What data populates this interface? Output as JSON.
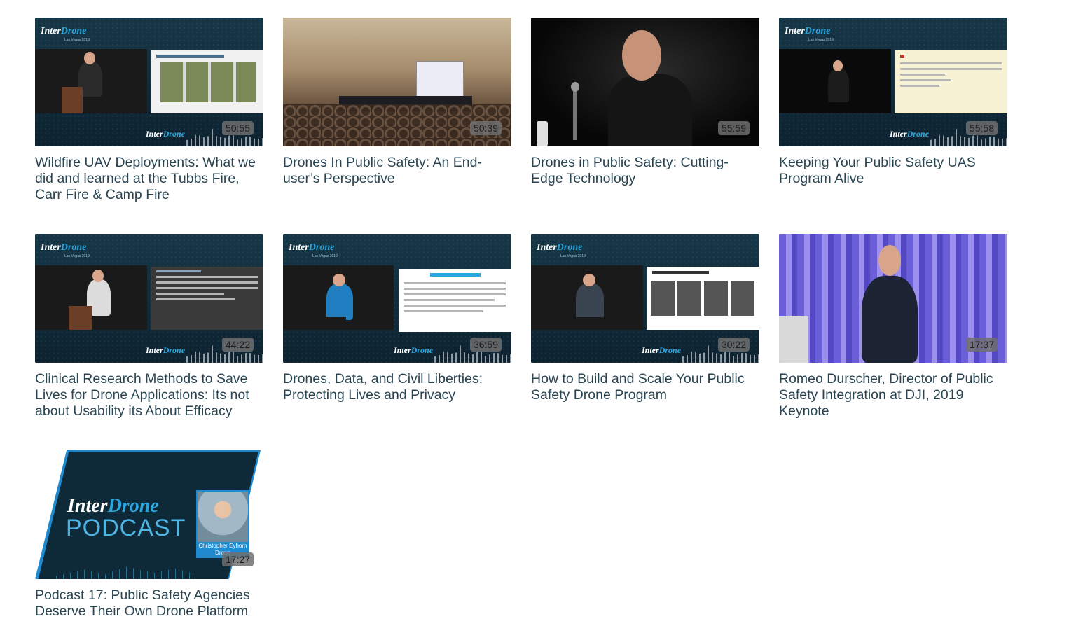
{
  "videos": [
    {
      "title": "Wildfire UAV Deployments: What we did and learned at the Tubbs Fire, Carr Fire & Camp Fire",
      "duration": "50:55",
      "thumbnail": "stage-slide"
    },
    {
      "title": "Drones In Public Safety: An End-user’s Perspective",
      "duration": "50:39",
      "thumbnail": "ballroom"
    },
    {
      "title": "Drones in Public Safety: Cutting-Edge Technology",
      "duration": "55:59",
      "thumbnail": "speaker-closeup"
    },
    {
      "title": "Keeping Your Public Safety UAS Program Alive",
      "duration": "55:58",
      "thumbnail": "stage-slide"
    },
    {
      "title": "Clinical Research Methods to Save Lives for Drone Applications: Its not about Usability its About Efficacy",
      "duration": "44:22",
      "thumbnail": "stage-slide"
    },
    {
      "title": "Drones, Data, and Civil Liberties: Protecting Lives and Privacy",
      "duration": "36:59",
      "thumbnail": "stage-slide"
    },
    {
      "title": "How to Build and Scale Your Public Safety Drone Program",
      "duration": "30:22",
      "thumbnail": "stage-slide"
    },
    {
      "title": "Romeo Durscher, Director of Public Safety Integration at DJI, 2019 Keynote",
      "duration": "17:37",
      "thumbnail": "keynote-stage"
    },
    {
      "title": "Podcast 17: Public Safety Agencies Deserve Their Own Drone Platform",
      "duration": "17:27",
      "thumbnail": "podcast"
    }
  ],
  "branding": {
    "logo_inter": "Inter",
    "logo_drone": "Drone",
    "logo_sub": "Las Vegas 2019",
    "podcast_word": "PODCAST",
    "podcast_guest": "Christopher Eyhorn Drone"
  },
  "colors": {
    "title_text": "#2a4552",
    "brand_dark": "#0f2a3a",
    "brand_blue": "#2aa7e0"
  }
}
